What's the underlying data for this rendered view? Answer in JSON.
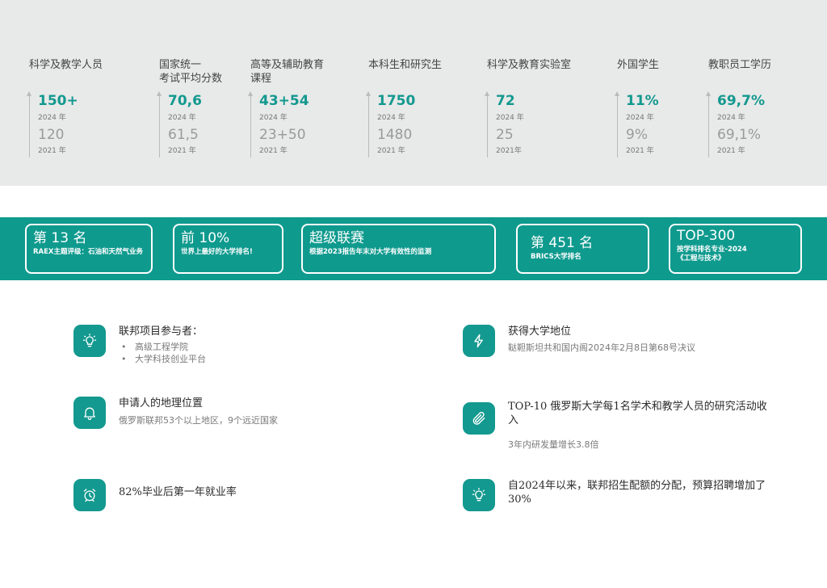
{
  "stats": [
    {
      "title": "科学及教学人员",
      "now": "150+",
      "now_year": "2024 年",
      "old": "120",
      "old_year": "2021 年"
    },
    {
      "title": "国家统一\n考试平均分数",
      "now": "70,6",
      "now_year": "2024 年",
      "old": "61,5",
      "old_year": "2021 年"
    },
    {
      "title": "高等及辅助教育\n课程",
      "now": "43+54",
      "now_year": "2024 年",
      "old": "23+50",
      "old_year": "2021 年"
    },
    {
      "title": "本科生和研究生",
      "now": "1750",
      "now_year": "2024 年",
      "old": "1480",
      "old_year": "2021 年"
    },
    {
      "title": "科学及教育实验室",
      "now": "72",
      "now_year": "2024 年",
      "old": "25",
      "old_year": "2021年"
    },
    {
      "title": "外国学生",
      "now": "11%",
      "now_year": "2024 年",
      "old": "9%",
      "old_year": "2021 年"
    },
    {
      "title": "教职员工学历",
      "now": "69,7%",
      "now_year": "2024 年",
      "old": "69,1%",
      "old_year": "2021 年"
    }
  ],
  "rankings": [
    {
      "big": "第 13 名",
      "small": "RAEX主题评级：石油和天然气业务"
    },
    {
      "big": "前 10%",
      "small": "世界上最好的大学排名!"
    },
    {
      "big": "超级联赛",
      "small": "根据2023报告年末对大学有效性的监测"
    },
    {
      "big": "第 451 名",
      "small": "BRICS大学排名"
    },
    {
      "big": "TOP-300",
      "small": "按学科排名专业-2024\n《工程与技术》"
    }
  ],
  "facts": {
    "federal": {
      "icon": "lightbulb-icon",
      "title": "联邦项目参与者：",
      "items": [
        "高级工程学院",
        "大学科技创业平台"
      ]
    },
    "status": {
      "icon": "lightning-icon",
      "title": "获得大学地位",
      "sub": "鞑靼斯坦共和国内阁2024年2月8日第68号决议"
    },
    "geo": {
      "icon": "bell-icon",
      "title": "申请人的地理位置",
      "sub": "俄罗斯联邦53个以上地区，9个远近国家"
    },
    "research": {
      "icon": "paperclip-icon",
      "title": "TOP-10 俄罗斯大学每1名学术和教学人员的研究活动收入",
      "sub": "3年内研发量增长3.8倍"
    },
    "employment": {
      "icon": "alarm-clock-icon",
      "title": "82%毕业后第一年就业率"
    },
    "quota": {
      "icon": "lightbulb-icon",
      "title": "自2024年以来，联邦招生配额的分配，预算招聘增加了30%"
    }
  },
  "colors": {
    "accent": "#13998f",
    "band": "#0f9a8e",
    "stats_bg": "#e8e9e9"
  }
}
